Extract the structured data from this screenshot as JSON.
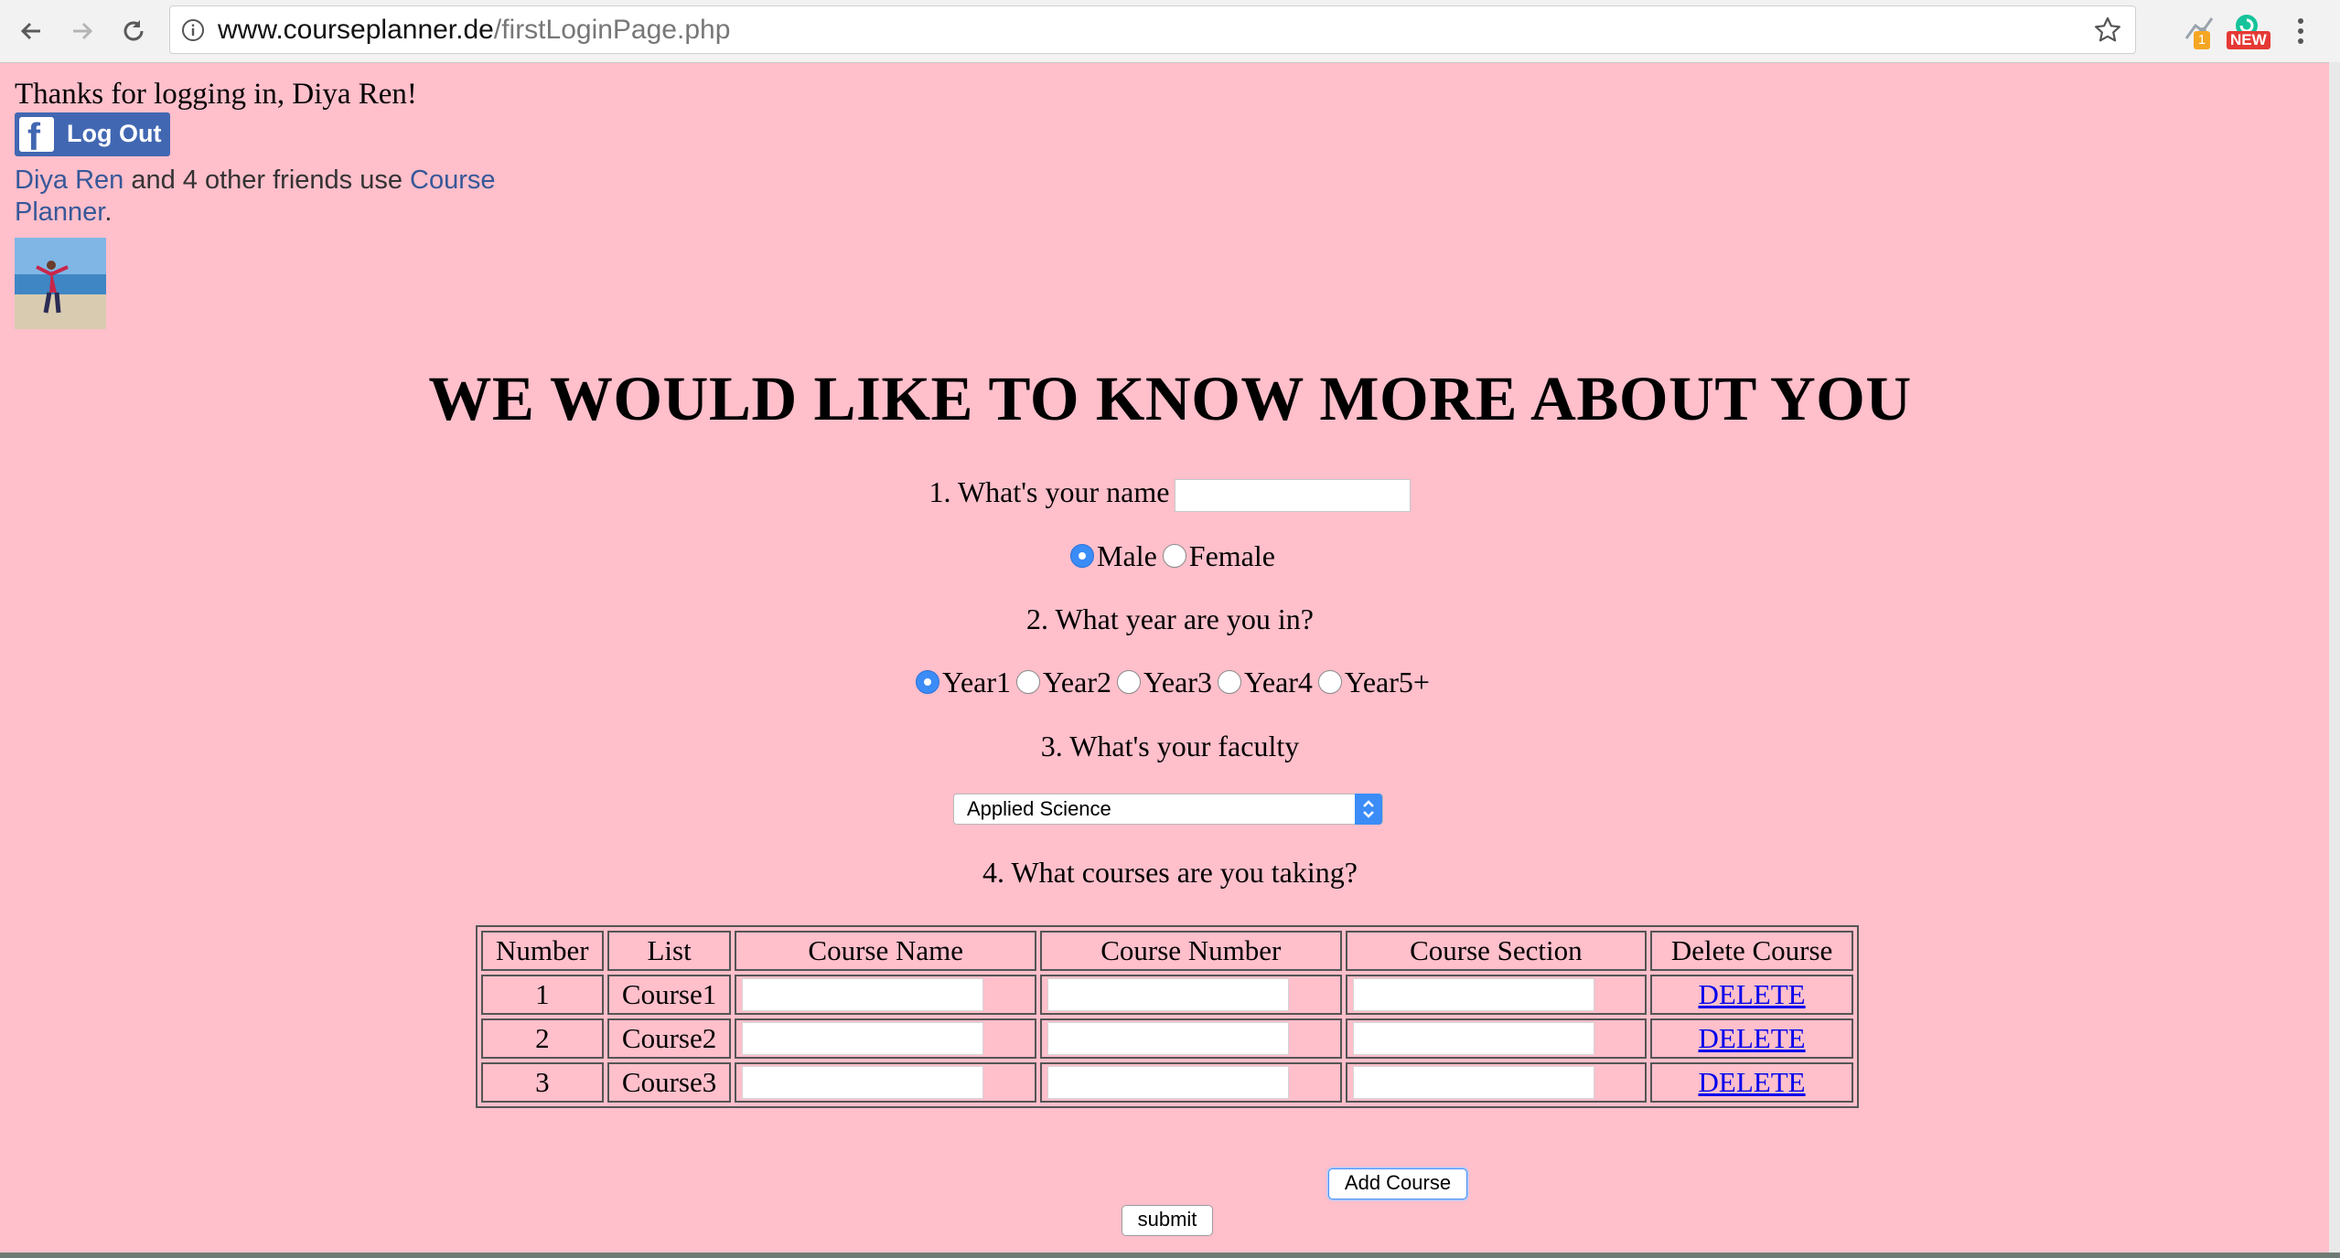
{
  "browser": {
    "url_host": "www.courseplanner.de",
    "url_path": "/firstLoginPage.php",
    "ext_badge_count": "1",
    "ext_badge_new": "NEW"
  },
  "page": {
    "thanks": "Thanks for logging in, Diya Ren!",
    "logout_label": "Log Out",
    "friends": {
      "name_link": "Diya Ren",
      "middle": " and 4 other friends use ",
      "app_link": "Course Planner",
      "end": "."
    },
    "heading": "WE WOULD LIKE TO KNOW MORE ABOUT YOU",
    "q1": "1. What's your name",
    "name_value": "",
    "gender_options": [
      {
        "label": "Male",
        "selected": true
      },
      {
        "label": "Female",
        "selected": false
      }
    ],
    "q2": "2. What year are you in?",
    "year_options": [
      {
        "label": "Year1",
        "selected": true
      },
      {
        "label": "Year2",
        "selected": false
      },
      {
        "label": "Year3",
        "selected": false
      },
      {
        "label": "Year4",
        "selected": false
      },
      {
        "label": "Year5+",
        "selected": false
      }
    ],
    "q3": "3. What's your faculty",
    "faculty_selected": "Applied Science",
    "q4": "4. What courses are you taking?",
    "table": {
      "headers": [
        "Number",
        "List",
        "Course Name",
        "Course Number",
        "Course Section",
        "Delete Course"
      ],
      "rows": [
        {
          "number": "1",
          "list": "Course1",
          "delete": "DELETE"
        },
        {
          "number": "2",
          "list": "Course2",
          "delete": "DELETE"
        },
        {
          "number": "3",
          "list": "Course3",
          "delete": "DELETE"
        }
      ]
    },
    "add_course_label": "Add Course",
    "submit_label": "submit"
  },
  "colors": {
    "page_bg": "#ffbfcb",
    "facebook_blue": "#4267b2",
    "link_blue": "#365899",
    "radio_selected": "#3b8cf7"
  }
}
